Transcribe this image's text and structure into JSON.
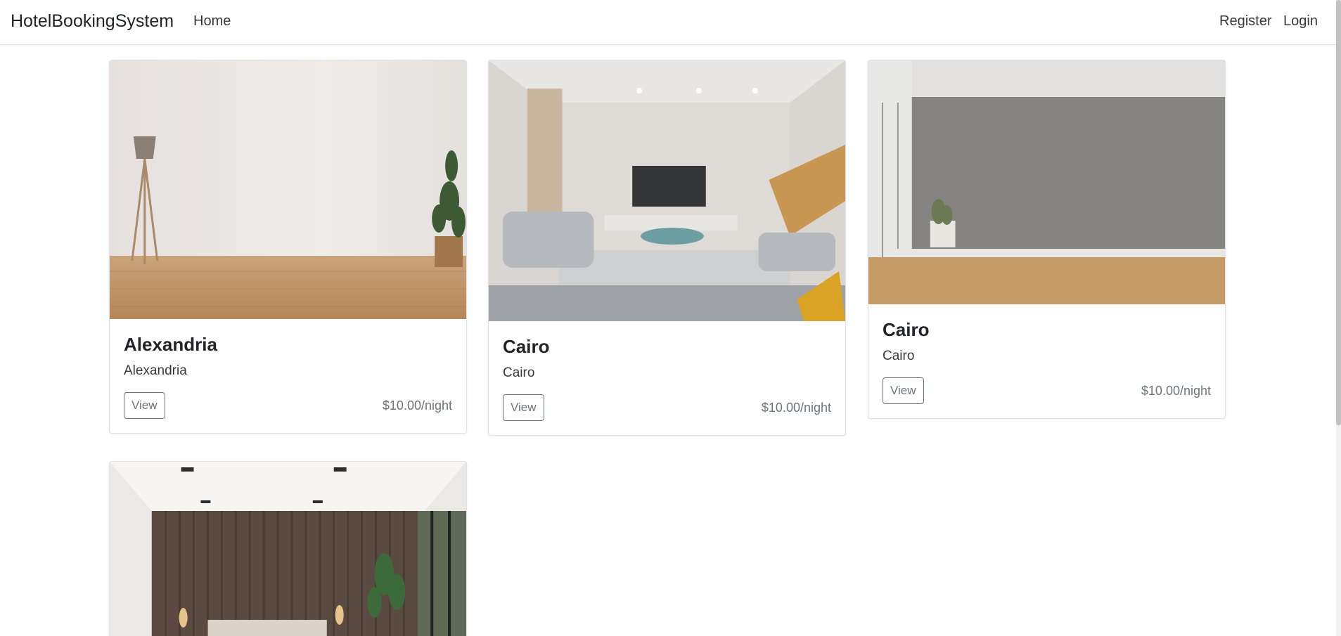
{
  "app": {
    "brand": "HotelBookingSystem"
  },
  "nav": {
    "home": "Home",
    "register": "Register",
    "login": "Login"
  },
  "colors": {
    "text": "#212529",
    "muted": "#6c757d",
    "border": "#dee2e6"
  },
  "hotels": [
    {
      "title": "Alexandria",
      "city": "Alexandria",
      "view_label": "View",
      "price": "$10.00/night",
      "image": "empty-room-lamp-plant"
    },
    {
      "title": "Cairo",
      "city": "Cairo",
      "view_label": "View",
      "price": "$10.00/night",
      "image": "living-room-tv-sofa"
    },
    {
      "title": "Cairo",
      "city": "Cairo",
      "view_label": "View",
      "price": "$10.00/night",
      "image": "grey-wall-room"
    },
    {
      "title": "",
      "city": "",
      "view_label": "",
      "price": "",
      "image": "bedroom-wood-panels"
    }
  ]
}
